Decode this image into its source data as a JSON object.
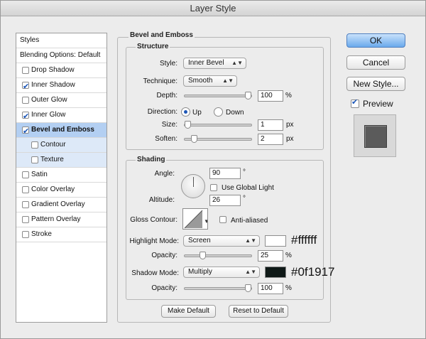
{
  "window": {
    "title": "Layer Style"
  },
  "styles_list": {
    "header": "Styles",
    "items": [
      {
        "label": "Blending Options: Default",
        "checkbox": false,
        "checked": false
      },
      {
        "label": "Drop Shadow",
        "checkbox": true,
        "checked": false
      },
      {
        "label": "Inner Shadow",
        "checkbox": true,
        "checked": true
      },
      {
        "label": "Outer Glow",
        "checkbox": true,
        "checked": false
      },
      {
        "label": "Inner Glow",
        "checkbox": true,
        "checked": true
      },
      {
        "label": "Bevel and Emboss",
        "checkbox": true,
        "checked": true,
        "selected": true
      },
      {
        "label": "Contour",
        "checkbox": true,
        "checked": false,
        "sub": true
      },
      {
        "label": "Texture",
        "checkbox": true,
        "checked": false,
        "sub": true
      },
      {
        "label": "Satin",
        "checkbox": true,
        "checked": false
      },
      {
        "label": "Color Overlay",
        "checkbox": true,
        "checked": false
      },
      {
        "label": "Gradient Overlay",
        "checkbox": true,
        "checked": false
      },
      {
        "label": "Pattern Overlay",
        "checkbox": true,
        "checked": false
      },
      {
        "label": "Stroke",
        "checkbox": true,
        "checked": false
      }
    ]
  },
  "bevel": {
    "title": "Bevel and Emboss",
    "structure": {
      "title": "Structure",
      "style_label": "Style:",
      "style_value": "Inner Bevel",
      "technique_label": "Technique:",
      "technique_value": "Smooth",
      "depth_label": "Depth:",
      "depth_value": "100",
      "depth_unit": "%",
      "depth_level": 1.0,
      "direction_label": "Direction:",
      "direction_up": "Up",
      "direction_down": "Down",
      "direction_selected": "Up",
      "size_label": "Size:",
      "size_value": "1",
      "size_unit": "px",
      "size_level": 0.0,
      "soften_label": "Soften:",
      "soften_value": "2",
      "soften_unit": "px",
      "soften_level": 0.1
    },
    "shading": {
      "title": "Shading",
      "angle_label": "Angle:",
      "angle_value": "90",
      "angle_unit": "°",
      "global_light_label": "Use Global Light",
      "global_light_checked": false,
      "altitude_label": "Altitude:",
      "altitude_value": "26",
      "altitude_unit": "°",
      "gloss_contour_label": "Gloss Contour:",
      "anti_aliased_label": "Anti-aliased",
      "anti_aliased_checked": false,
      "highlight_mode_label": "Highlight Mode:",
      "highlight_mode_value": "Screen",
      "highlight_color": "#ffffff",
      "highlight_color_note": "#ffffff",
      "highlight_opacity_label": "Opacity:",
      "highlight_opacity_value": "25",
      "highlight_opacity_unit": "%",
      "highlight_opacity_level": 0.25,
      "shadow_mode_label": "Shadow Mode:",
      "shadow_mode_value": "Multiply",
      "shadow_color": "#0f1917",
      "shadow_color_note": "#0f1917",
      "shadow_opacity_label": "Opacity:",
      "shadow_opacity_value": "100",
      "shadow_opacity_unit": "%",
      "shadow_opacity_level": 1.0
    },
    "make_default_label": "Make Default",
    "reset_default_label": "Reset to Default"
  },
  "buttons": {
    "ok_label": "OK",
    "cancel_label": "Cancel",
    "new_style_label": "New Style...",
    "preview_label": "Preview",
    "preview_checked": true
  }
}
